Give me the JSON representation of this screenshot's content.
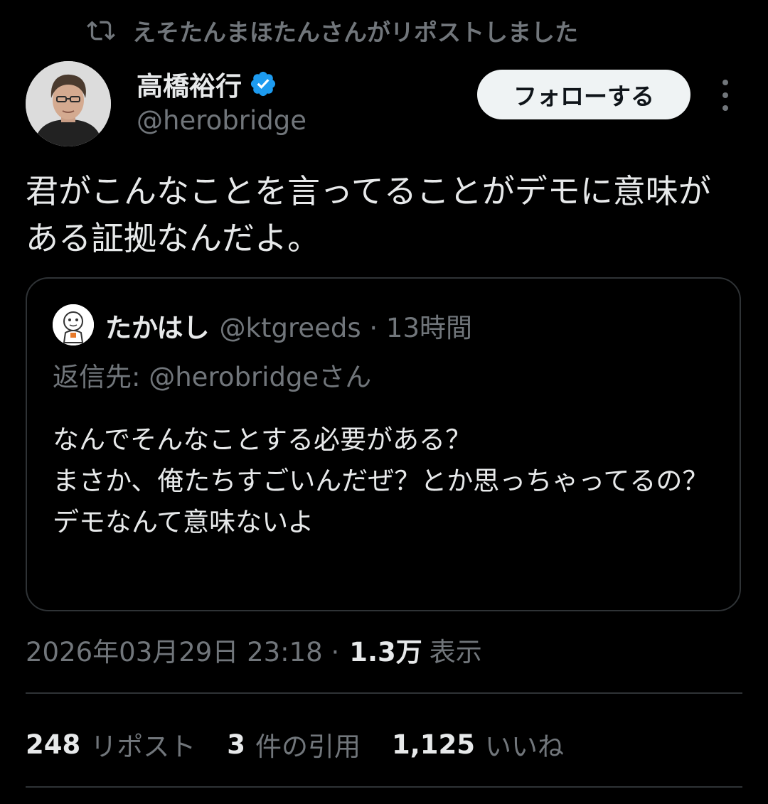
{
  "repost_banner": {
    "text": "えそたんまほたんさんがリポストしました",
    "icon": "repost-icon"
  },
  "author": {
    "name": "高橋裕行",
    "handle": "@herobridge",
    "verified_icon": "verified-badge-icon",
    "verified_color": "#1d9bf0"
  },
  "follow_button": {
    "label": "フォローする"
  },
  "more_button": {
    "icon": "more-vertical-icon"
  },
  "tweet": {
    "text": "君がこんなことを言ってることがデモに意味がある証拠なんだよ。"
  },
  "quote": {
    "name": "たかはし",
    "handle": "@ktgreeds · 13時間",
    "reply_to": "返信先: @herobridgeさん",
    "lines": [
      "なんでそんなことする必要がある？",
      "まさか、俺たちすごいんだぜ？とか思っちゃってるの？",
      "デモなんて意味ないよ"
    ]
  },
  "meta": {
    "timestamp": "2026年03月29日 23:18 ·",
    "views_count": "1.3万",
    "views_label": "表示"
  },
  "stats": [
    {
      "count": "248",
      "label": "リポスト"
    },
    {
      "count": "3",
      "label": "件の引用"
    },
    {
      "count": "1,125",
      "label": "いいね"
    }
  ],
  "colors": {
    "background": "#000000",
    "primary_text": "#e7e9ea",
    "secondary_text": "#71767b",
    "border": "#2f3336",
    "follow_bg": "#eff3f4"
  }
}
